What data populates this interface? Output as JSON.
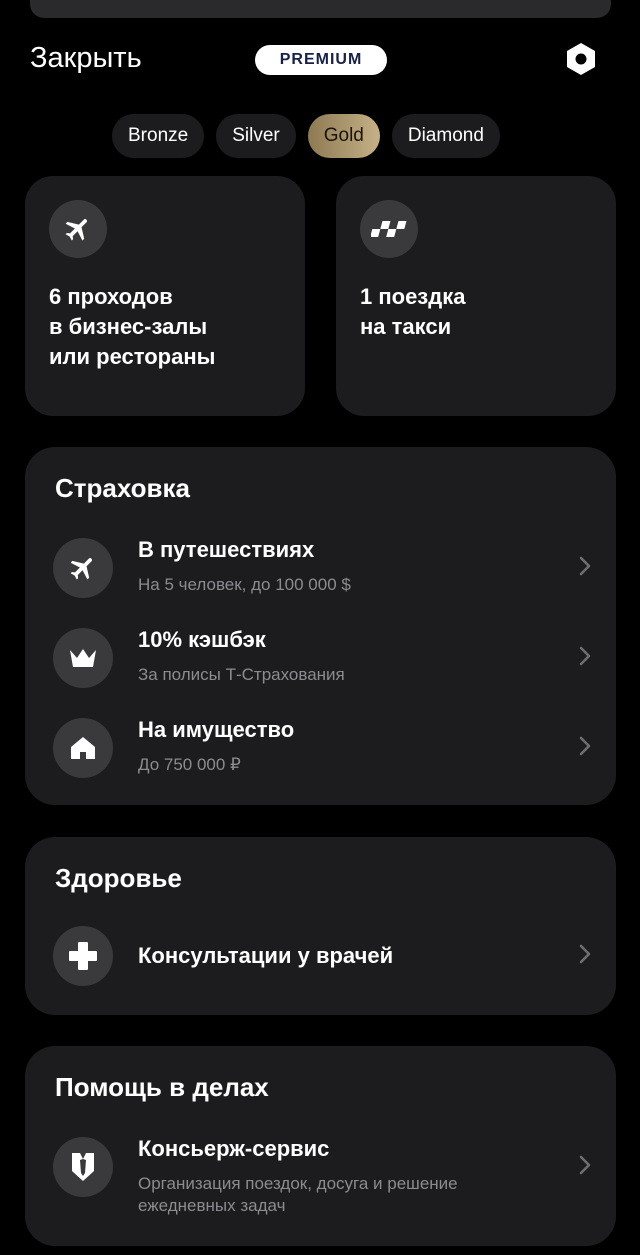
{
  "header": {
    "close_label": "Закрыть",
    "badge": "PREMIUM",
    "settings_icon": "hexagon-settings-icon"
  },
  "tiers": [
    {
      "label": "Bronze",
      "active": false
    },
    {
      "label": "Silver",
      "active": false
    },
    {
      "label": "Gold",
      "active": true
    },
    {
      "label": "Diamond",
      "active": false
    }
  ],
  "perks": [
    {
      "icon": "airplane-icon",
      "text": "6 проходов\nв бизнес-залы\nили рестораны"
    },
    {
      "icon": "taxi-checker-icon",
      "text": "1 поездка\nна такси"
    }
  ],
  "insurance": {
    "title": "Страховка",
    "items": [
      {
        "icon": "airplane-icon",
        "title": "В путешествиях",
        "subtitle": "На 5 человек, до 100 000 $"
      },
      {
        "icon": "crown-icon",
        "title": "10% кэшбэк",
        "subtitle": "За полисы Т-Страхования"
      },
      {
        "icon": "house-icon",
        "title": "На имущество",
        "subtitle": "До 750 000 ₽"
      }
    ]
  },
  "health": {
    "title": "Здоровье",
    "items": [
      {
        "icon": "medical-cross-icon",
        "title": "Консультации у врачей"
      }
    ]
  },
  "assistance": {
    "title": "Помощь в делах",
    "items": [
      {
        "icon": "concierge-tie-icon",
        "title": "Консьерж-сервис",
        "subtitle": "Организация поездок, досуга и решение ежедневных задач"
      }
    ]
  },
  "colors": {
    "background": "#000000",
    "card": "#1c1c1e",
    "icon_circle": "#3a3a3d",
    "gold_start": "#8d7a53",
    "gold_end": "#c6b187",
    "badge_text": "#17204a"
  }
}
